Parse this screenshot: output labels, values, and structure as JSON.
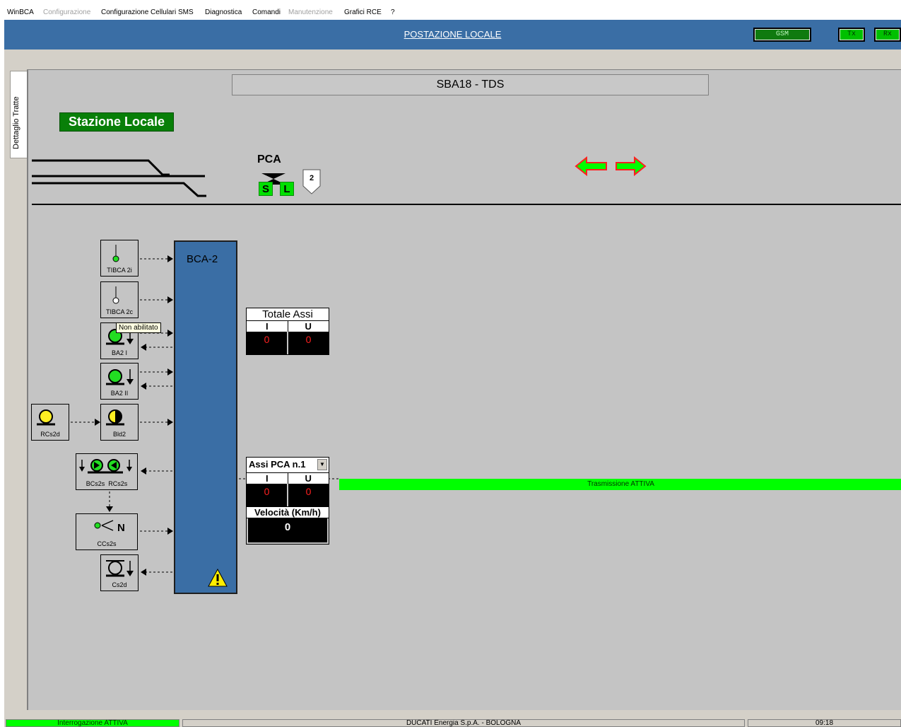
{
  "menu": {
    "items": [
      {
        "label": "WinBCA",
        "enabled": true
      },
      {
        "label": "Configurazione",
        "enabled": false
      },
      {
        "label": "Configurazione Cellulari SMS",
        "enabled": true
      },
      {
        "label": "Diagnostica",
        "enabled": true
      },
      {
        "label": "Comandi",
        "enabled": true
      },
      {
        "label": "Manutenzione",
        "enabled": false
      },
      {
        "label": "Grafici RCE",
        "enabled": true
      },
      {
        "label": "?",
        "enabled": true
      }
    ]
  },
  "header": {
    "title": "POSTAZIONE LOCALE",
    "indicators": {
      "gsm": "GSM",
      "tx": "Tx",
      "rx": "Rx"
    }
  },
  "side_tab": {
    "label": "Dettaglio Tratte"
  },
  "station": {
    "title": "SBA18 - TDS",
    "label": "Stazione Locale"
  },
  "track": {
    "pca_label": "PCA",
    "s_label": "S",
    "l_label": "L",
    "section_number": "2",
    "arrows": "left-right",
    "arrow_color": "#ff2020",
    "arrow_fill": "#00ff00"
  },
  "bca": {
    "label": "BCA-2",
    "warning_icon": "warning-triangle-icon"
  },
  "devices": {
    "tibca2i": "TIBCA 2i",
    "tibca2c": "TIBCA 2c",
    "ba2i": "BA2 I",
    "ba2ii": "BA2 II",
    "rcs2d": "RCs2d",
    "bld2": "Bld2",
    "bcs2s": "BCs2s",
    "rcs2s": "RCs2s",
    "ccs2s": "CCs2s",
    "cs2d": "Cs2d"
  },
  "tooltip": "Non abilitato",
  "totale_assi": {
    "title": "Totale Assi",
    "col_i": "I",
    "col_u": "U",
    "val_i": "0",
    "val_u": "0"
  },
  "assi_pca": {
    "selected": "Assi PCA n.1",
    "col_i": "I",
    "col_u": "U",
    "val_i": "0",
    "val_u": "0",
    "speed_label": "Velocità (Km/h)",
    "speed_value": "0"
  },
  "transmission": "Trasmissione ATTIVA",
  "status": {
    "left": "Interrogazione ATTIVA",
    "center": "DUCATI Energia S.p.A.  -  BOLOGNA",
    "time": "09:18"
  },
  "colors": {
    "header_blue": "#3a6ea5",
    "active_green": "#00ff00",
    "station_green": "#087f08",
    "panel_grey": "#c4c4c4"
  }
}
